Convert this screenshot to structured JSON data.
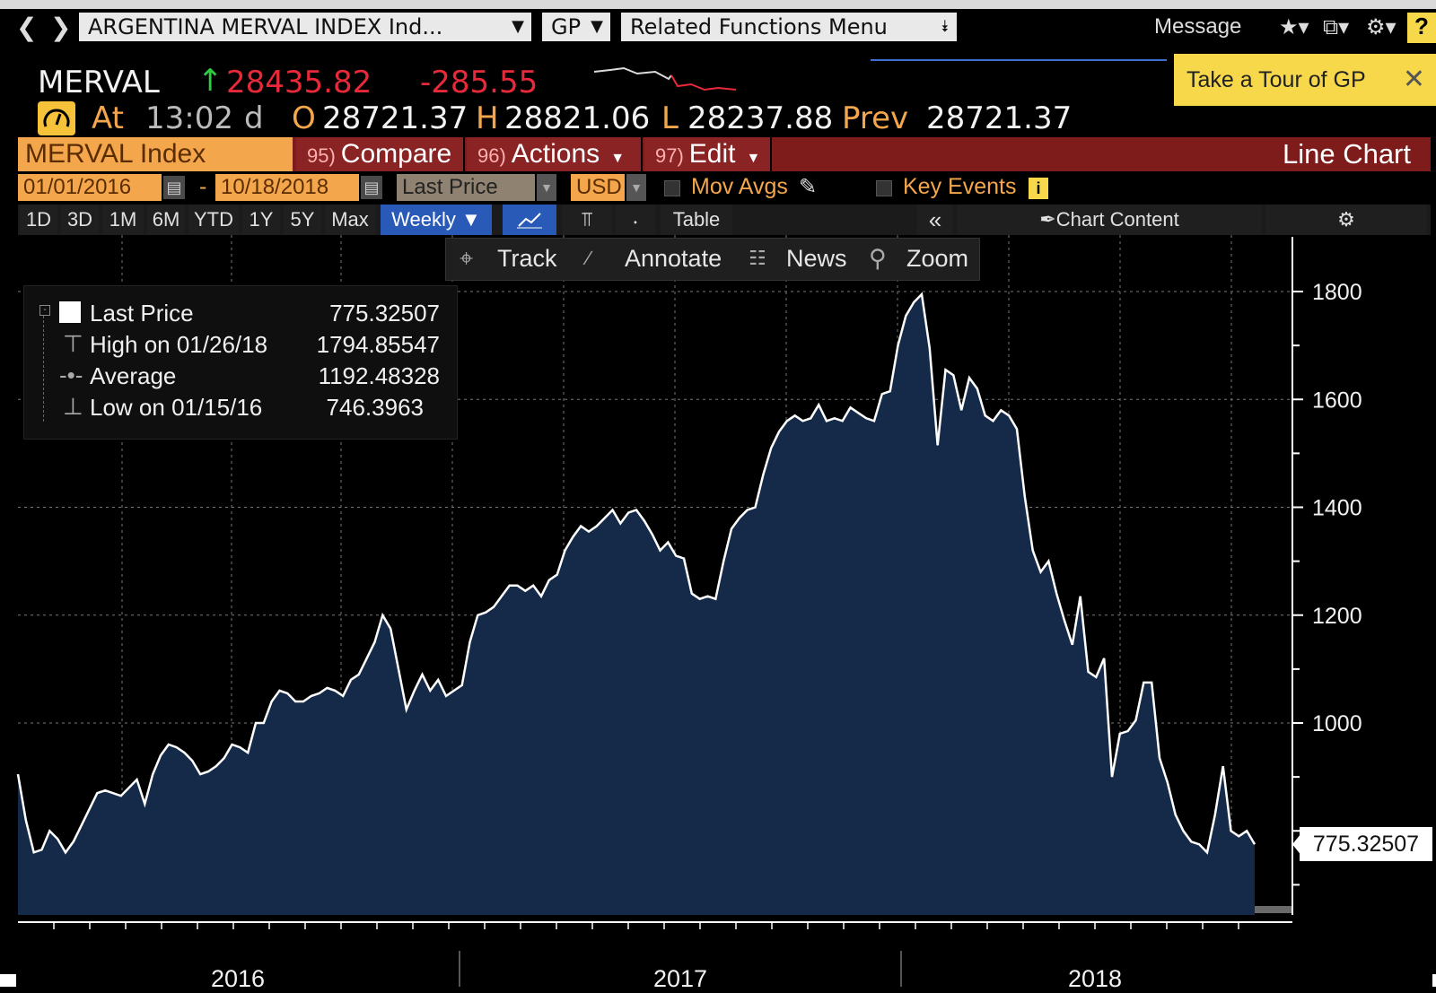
{
  "toolbar": {
    "security_field": "ARGENTINA MERVAL INDEX Ind...",
    "function_field": "GP",
    "related_menu": "Related Functions Menu",
    "message_label": "Message"
  },
  "quote": {
    "ticker": "MERVAL",
    "last": "28435.82",
    "change": "-285.55",
    "time_label": "At",
    "time": "13:02",
    "time_suffix": "d",
    "open_label": "O",
    "open": "28721.37",
    "high_label": "H",
    "high": "28821.06",
    "low_label": "L",
    "low": "28237.88",
    "prev_label": "Prev",
    "prev": "28721.37"
  },
  "tour_banner": "Take a Tour of GP",
  "menu_bar": {
    "security": "MERVAL Index",
    "compare_num": "95)",
    "compare": "Compare",
    "actions_num": "96)",
    "actions": "Actions",
    "edit_num": "97)",
    "edit": "Edit",
    "chart_type": "Line Chart"
  },
  "params": {
    "start_date": "01/01/2016",
    "separator": "-",
    "end_date": "10/18/2018",
    "field": "Last Price",
    "currency": "USD",
    "mov_avgs": "Mov Avgs",
    "key_events": "Key Events"
  },
  "periods": [
    "1D",
    "3D",
    "1M",
    "6M",
    "YTD",
    "1Y",
    "5Y",
    "Max"
  ],
  "frequency": "Weekly",
  "table_label": "Table",
  "chart_content_label": "Chart Content",
  "tools": [
    "Track",
    "Annotate",
    "News",
    "Zoom"
  ],
  "legend": {
    "last_price_label": "Last Price",
    "last_price_value": "775.32507",
    "high_label": "High on 01/26/18",
    "high_value": "1794.85547",
    "average_label": "Average",
    "average_value": "1192.48328",
    "low_label": "Low on 01/15/16",
    "low_value": "746.3963"
  },
  "colors": {
    "line": "#ffffff",
    "area_fill": "#142a48",
    "accent_orange": "#f4a64c",
    "bar_red": "#7e1c1c",
    "positive_green": "#2ecc40",
    "negative_red": "#e8293a"
  },
  "chart_data": {
    "type": "area",
    "x_frequency": "weekly",
    "x_start": "2016-01-01",
    "x_end": "2018-10-18",
    "x_tick_labels": [
      "2016",
      "2017",
      "2018"
    ],
    "y_ticks": [
      1000,
      1200,
      1400,
      1600,
      1800
    ],
    "ylim": [
      625,
      1850
    ],
    "grid": true,
    "last_value_label": "775.32507",
    "series": [
      {
        "values": [
          905,
          820,
          760,
          765,
          800,
          785,
          760,
          780,
          810,
          840,
          870,
          875,
          870,
          865,
          880,
          895,
          850,
          905,
          940,
          960,
          955,
          945,
          930,
          905,
          910,
          920,
          935,
          960,
          955,
          945,
          1000,
          1000,
          1040,
          1060,
          1055,
          1040,
          1040,
          1050,
          1055,
          1065,
          1060,
          1050,
          1080,
          1090,
          1120,
          1150,
          1200,
          1175,
          1100,
          1025,
          1060,
          1090,
          1060,
          1080,
          1050,
          1060,
          1070,
          1150,
          1200,
          1205,
          1215,
          1235,
          1255,
          1255,
          1245,
          1255,
          1235,
          1265,
          1275,
          1320,
          1345,
          1365,
          1355,
          1365,
          1380,
          1395,
          1370,
          1390,
          1395,
          1375,
          1350,
          1320,
          1335,
          1310,
          1305,
          1240,
          1230,
          1235,
          1230,
          1300,
          1360,
          1380,
          1395,
          1400,
          1460,
          1510,
          1540,
          1560,
          1570,
          1560,
          1565,
          1590,
          1560,
          1565,
          1560,
          1585,
          1575,
          1565,
          1560,
          1610,
          1615,
          1700,
          1755,
          1780,
          1795,
          1695,
          1515,
          1655,
          1645,
          1580,
          1640,
          1620,
          1570,
          1560,
          1580,
          1570,
          1545,
          1420,
          1320,
          1280,
          1300,
          1240,
          1190,
          1145,
          1235,
          1095,
          1085,
          1120,
          900,
          980,
          985,
          1005,
          1075,
          1075,
          935,
          890,
          830,
          800,
          780,
          775,
          760,
          830,
          920,
          800,
          790,
          800,
          775
        ]
      }
    ]
  }
}
